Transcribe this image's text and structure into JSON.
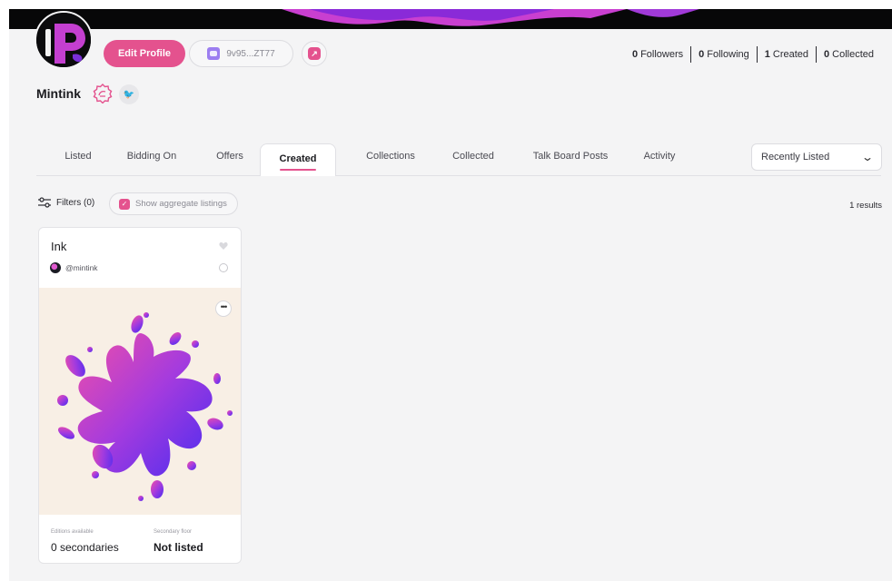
{
  "colors": {
    "accent": "#e4528e",
    "wallet": "#9c7ef0",
    "page_bg": "#f4f4f5"
  },
  "profile": {
    "edit_label": "Edit Profile",
    "wallet": "9v95...ZT77",
    "username": "Mintink",
    "stats": [
      {
        "count": "0",
        "label": "Followers"
      },
      {
        "count": "0",
        "label": "Following"
      },
      {
        "count": "1",
        "label": "Created"
      },
      {
        "count": "0",
        "label": "Collected"
      }
    ]
  },
  "tabs": [
    {
      "label": "Listed"
    },
    {
      "label": "Bidding On"
    },
    {
      "label": "Offers"
    },
    {
      "label": "Created"
    },
    {
      "label": "Collections"
    },
    {
      "label": "Collected"
    },
    {
      "label": "Talk Board Posts"
    },
    {
      "label": "Activity"
    }
  ],
  "active_tab": "Created",
  "sort": {
    "value": "Recently Listed"
  },
  "filters": {
    "label": "Filters (0)",
    "aggregate_label": "Show aggregate listings",
    "aggregate_checked": true,
    "results": "1 results"
  },
  "card": {
    "title": "Ink",
    "handle": "@mintink",
    "editions_label": "Editions available",
    "editions_value": "0 secondaries",
    "floor_label": "Secondary floor",
    "floor_value": "Not listed"
  },
  "icons": [
    "edit-profile",
    "wallet-icon",
    "share-icon",
    "badge-icon",
    "twitter-icon",
    "filters-icon",
    "heart-icon",
    "settings-icon",
    "more-icon",
    "chevron-down-icon"
  ]
}
